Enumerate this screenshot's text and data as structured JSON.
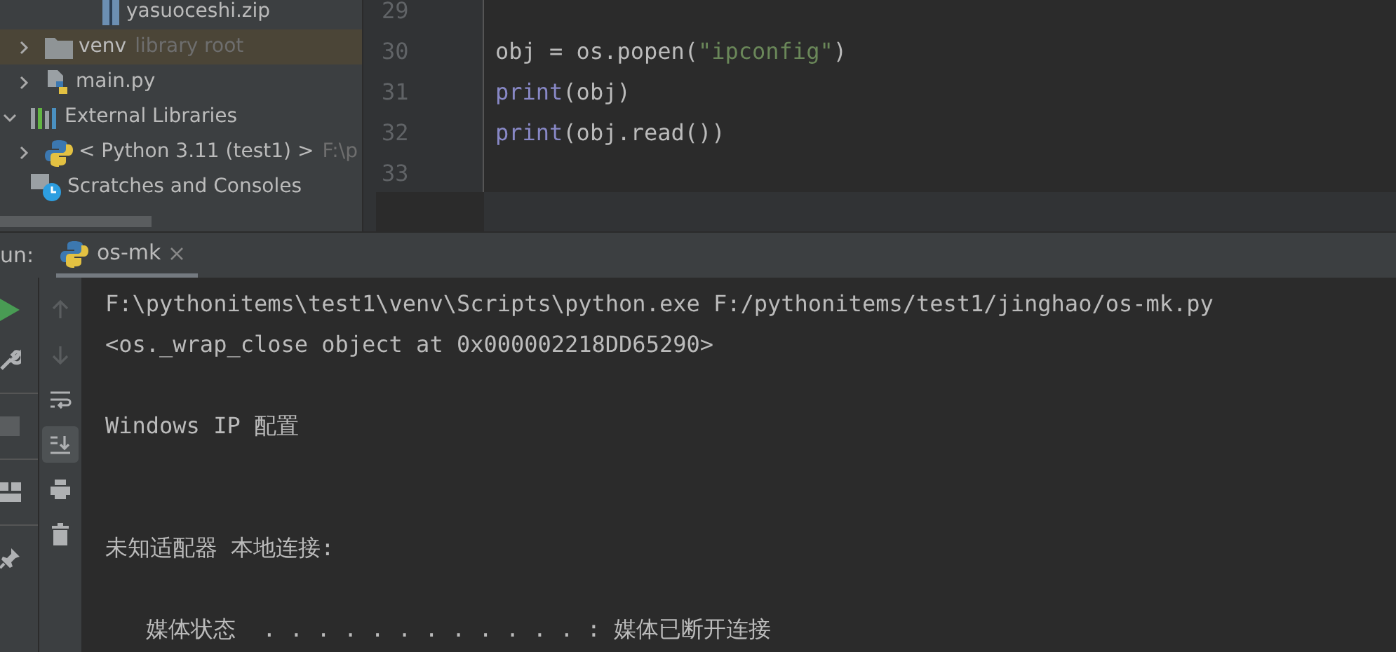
{
  "project_tree": {
    "items": [
      {
        "kind": "zip",
        "label": "yasuoceshi.zip",
        "selected": false
      },
      {
        "kind": "folder",
        "label": "venv",
        "hint": "library root",
        "expanded": false,
        "selected": true
      },
      {
        "kind": "python-file",
        "label": "main.py",
        "expanded": false,
        "selected": false
      },
      {
        "kind": "libraries",
        "label": "External Libraries",
        "expanded": true,
        "selected": false,
        "children": [
          {
            "kind": "python-sdk",
            "label": "< Python 3.11 (test1) >",
            "hint": "F:\\p",
            "expanded": false,
            "selected": false
          }
        ]
      },
      {
        "kind": "scratches",
        "label": "Scratches and Consoles",
        "selected": false
      }
    ]
  },
  "editor": {
    "lines": [
      {
        "number": "29"
      },
      {
        "number": "30",
        "tokens": [
          {
            "kind": "plain",
            "text": "obj = os.popen("
          },
          {
            "kind": "string",
            "text": "\"ipconfig\""
          },
          {
            "kind": "plain",
            "text": ")"
          }
        ]
      },
      {
        "number": "31",
        "tokens": [
          {
            "kind": "builtin",
            "text": "print"
          },
          {
            "kind": "plain",
            "text": "(obj)"
          }
        ]
      },
      {
        "number": "32",
        "tokens": [
          {
            "kind": "builtin",
            "text": "print"
          },
          {
            "kind": "plain",
            "text": "(obj.read())"
          }
        ]
      },
      {
        "number": "33"
      }
    ]
  },
  "run_panel": {
    "label": "un:",
    "tabs": [
      {
        "label": "os-mk",
        "selected": true
      }
    ],
    "left_toolbar": [
      {
        "kind": "run"
      },
      {
        "kind": "wrench"
      },
      {
        "kind": "stop"
      },
      {
        "kind": "layout"
      },
      {
        "kind": "pin"
      }
    ],
    "console_toolbar": [
      {
        "kind": "up",
        "disabled": true,
        "selected": false
      },
      {
        "kind": "down",
        "disabled": true,
        "selected": false
      },
      {
        "kind": "wrap",
        "disabled": false,
        "selected": false
      },
      {
        "kind": "scroll-end",
        "disabled": false,
        "selected": true
      },
      {
        "kind": "print",
        "disabled": false,
        "selected": false
      },
      {
        "kind": "trash",
        "disabled": false,
        "selected": false
      }
    ],
    "console_lines": [
      "F:\\pythonitems\\test1\\venv\\Scripts\\python.exe F:/pythonitems/test1/jinghao/os-mk.py",
      "<os._wrap_close object at 0x000002218DD65290>",
      "Windows IP 配置",
      "未知适配器 本地连接:",
      "   媒体状态  . . . . . . . . . . . . : 媒体已断开连接"
    ]
  }
}
